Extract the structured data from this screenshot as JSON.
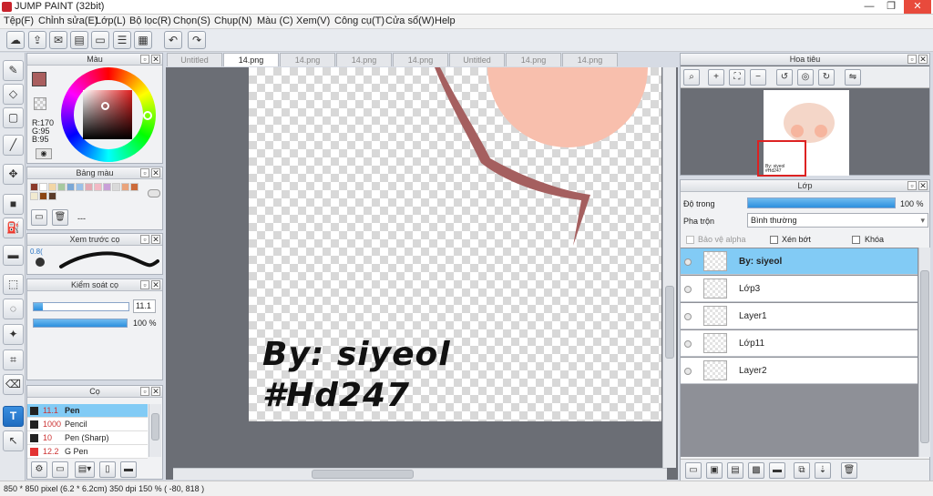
{
  "window": {
    "title": "JUMP PAINT (32bit)"
  },
  "menu": [
    "Tệp(F)",
    "Chỉnh sửa(E)",
    "Lớp(L)",
    "Bộ lọc(R)",
    "Chọn(S)",
    "Chụp(N)",
    "Màu (C)",
    "Xem(V)",
    "Công cụ(T)",
    "Cửa sổ(W)",
    "Help"
  ],
  "tabs": [
    "Untitled",
    "14.png",
    "14.png",
    "14.png",
    "14.png",
    "Untitled",
    "14.png",
    "14.png"
  ],
  "color_panel": {
    "title": "Màu",
    "r": "R:170",
    "g": "G:95",
    "b": "B:95",
    "color": "#aa5f5f"
  },
  "palette_panel": {
    "title": "Bảng màu",
    "empty": "---",
    "swatches": [
      "#8b3a2b",
      "#ffffff",
      "#f2d6a6",
      "#a6c9a0",
      "#7aa7d6",
      "#9ac0e8",
      "#e4a9b4",
      "#f3b8c4",
      "#c9a0d8",
      "#d9d9d9",
      "#eaa47c",
      "#cc6a3a",
      "#f1ead0",
      "#8b4513",
      "#5a3b2a"
    ]
  },
  "brush_preview_panel": {
    "title": "Xem trước cọ",
    "size_label": "0.8("
  },
  "brush_control_panel": {
    "title": "Kiểm soát cọ",
    "size": "11.1",
    "opacity": "100 %",
    "size_level": 0.1,
    "opacity_level": 1.0
  },
  "brush_panel": {
    "title": "Cọ",
    "items": [
      {
        "size": "11.1",
        "name": "Pen",
        "selected": true,
        "color": "#222222"
      },
      {
        "size": "1000",
        "name": "Pencil",
        "selected": false,
        "color": "#222222"
      },
      {
        "size": "10",
        "name": "Pen (Sharp)",
        "selected": false,
        "color": "#222222"
      },
      {
        "size": "12.2",
        "name": "G Pen",
        "selected": false,
        "color": "#e33333"
      }
    ]
  },
  "canvas": {
    "text_line1": "By: siyeol",
    "text_line2": "#Hd247"
  },
  "navigator_panel": {
    "title": "Hoa tiêu",
    "thumb_text": "By: siyeol #Hd247"
  },
  "layer_panel": {
    "title": "Lớp",
    "opacity_label": "Độ trong",
    "opacity_value": "100 %",
    "opacity_level": 1.0,
    "blend_label": "Pha trộn",
    "blend_value": "Bình thường",
    "protect_alpha": "Bảo vệ alpha",
    "clip": "Xén bớt",
    "lock": "Khóa",
    "layers": [
      {
        "name": "By: siyeol",
        "selected": true
      },
      {
        "name": "Lớp3",
        "selected": false
      },
      {
        "name": "Layer1",
        "selected": false
      },
      {
        "name": "Lớp11",
        "selected": false
      },
      {
        "name": "Layer2",
        "selected": false
      }
    ]
  },
  "statusbar": {
    "text": "850 * 850 pixel   (6.2 * 6.2cm)   350 dpi   150 %   ( -80, 818 )"
  }
}
